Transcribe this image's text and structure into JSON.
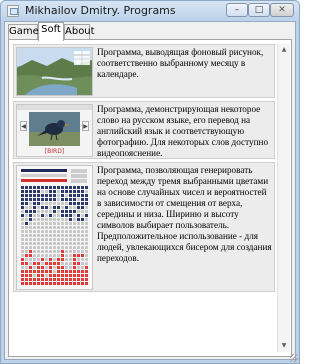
{
  "window": {
    "title": "Mikhailov Dmitry. Programs",
    "controls": {
      "minimize": "–",
      "maximize": "□",
      "close": "✕"
    }
  },
  "tabs": [
    {
      "label": "Games",
      "selected": false
    },
    {
      "label": "Soft",
      "selected": true
    },
    {
      "label": "About",
      "selected": false
    }
  ],
  "programs": [
    {
      "description": "Программа, выводящая фоновый рисунок, соответственно выбранному месяцу в календаре.",
      "thumbnail": "calendar-wallpaper-screenshot"
    },
    {
      "description": "Программа, демонстрирующая некоторое слово на русском языке, его перевод на английский язык и соответствующую фотографию. Для некоторых слов доступно видеопояснение.",
      "thumbnail": "bird-word-card-screenshot",
      "thumb_caption": "[BIRD]"
    },
    {
      "description": "Программа, позволяющая генерировать переход между тремя выбранными цветами на основе случайных чисел и вероятностей в зависимости от смещения от верха, середины и низа. Шириню и высоту символов выбирает пользователь. Предположительное использование - для людей, увлекающихся бисером для создания переходов.",
      "thumbnail": "bead-gradient-screenshot"
    }
  ],
  "scrollbar": {
    "up": "▲",
    "down": "▼"
  },
  "colors": {
    "bead_top": "#2b3a6a",
    "bead_mid": "#c9c9c9",
    "bead_bottom": "#e23a3a"
  }
}
